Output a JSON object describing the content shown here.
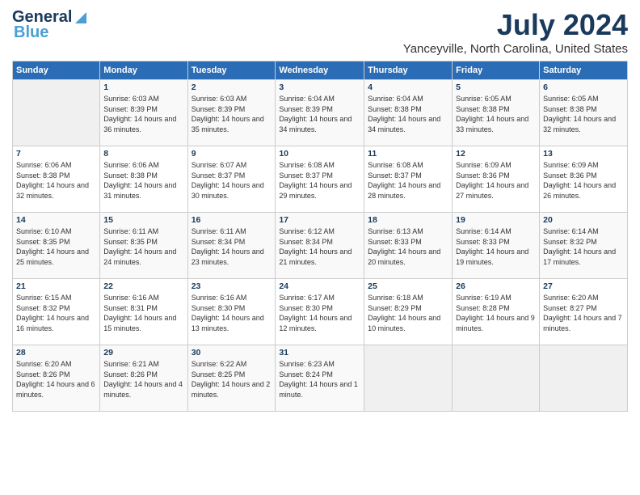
{
  "logo": {
    "line1": "General",
    "line2": "Blue"
  },
  "title": "July 2024",
  "subtitle": "Yanceyville, North Carolina, United States",
  "header": {
    "days": [
      "Sunday",
      "Monday",
      "Tuesday",
      "Wednesday",
      "Thursday",
      "Friday",
      "Saturday"
    ]
  },
  "weeks": [
    [
      {
        "num": "",
        "empty": true
      },
      {
        "num": "1",
        "rise": "6:03 AM",
        "set": "8:39 PM",
        "daylight": "14 hours and 36 minutes."
      },
      {
        "num": "2",
        "rise": "6:03 AM",
        "set": "8:39 PM",
        "daylight": "14 hours and 35 minutes."
      },
      {
        "num": "3",
        "rise": "6:04 AM",
        "set": "8:39 PM",
        "daylight": "14 hours and 34 minutes."
      },
      {
        "num": "4",
        "rise": "6:04 AM",
        "set": "8:38 PM",
        "daylight": "14 hours and 34 minutes."
      },
      {
        "num": "5",
        "rise": "6:05 AM",
        "set": "8:38 PM",
        "daylight": "14 hours and 33 minutes."
      },
      {
        "num": "6",
        "rise": "6:05 AM",
        "set": "8:38 PM",
        "daylight": "14 hours and 32 minutes."
      }
    ],
    [
      {
        "num": "7",
        "rise": "6:06 AM",
        "set": "8:38 PM",
        "daylight": "14 hours and 32 minutes."
      },
      {
        "num": "8",
        "rise": "6:06 AM",
        "set": "8:38 PM",
        "daylight": "14 hours and 31 minutes."
      },
      {
        "num": "9",
        "rise": "6:07 AM",
        "set": "8:37 PM",
        "daylight": "14 hours and 30 minutes."
      },
      {
        "num": "10",
        "rise": "6:08 AM",
        "set": "8:37 PM",
        "daylight": "14 hours and 29 minutes."
      },
      {
        "num": "11",
        "rise": "6:08 AM",
        "set": "8:37 PM",
        "daylight": "14 hours and 28 minutes."
      },
      {
        "num": "12",
        "rise": "6:09 AM",
        "set": "8:36 PM",
        "daylight": "14 hours and 27 minutes."
      },
      {
        "num": "13",
        "rise": "6:09 AM",
        "set": "8:36 PM",
        "daylight": "14 hours and 26 minutes."
      }
    ],
    [
      {
        "num": "14",
        "rise": "6:10 AM",
        "set": "8:35 PM",
        "daylight": "14 hours and 25 minutes."
      },
      {
        "num": "15",
        "rise": "6:11 AM",
        "set": "8:35 PM",
        "daylight": "14 hours and 24 minutes."
      },
      {
        "num": "16",
        "rise": "6:11 AM",
        "set": "8:34 PM",
        "daylight": "14 hours and 23 minutes."
      },
      {
        "num": "17",
        "rise": "6:12 AM",
        "set": "8:34 PM",
        "daylight": "14 hours and 21 minutes."
      },
      {
        "num": "18",
        "rise": "6:13 AM",
        "set": "8:33 PM",
        "daylight": "14 hours and 20 minutes."
      },
      {
        "num": "19",
        "rise": "6:14 AM",
        "set": "8:33 PM",
        "daylight": "14 hours and 19 minutes."
      },
      {
        "num": "20",
        "rise": "6:14 AM",
        "set": "8:32 PM",
        "daylight": "14 hours and 17 minutes."
      }
    ],
    [
      {
        "num": "21",
        "rise": "6:15 AM",
        "set": "8:32 PM",
        "daylight": "14 hours and 16 minutes."
      },
      {
        "num": "22",
        "rise": "6:16 AM",
        "set": "8:31 PM",
        "daylight": "14 hours and 15 minutes."
      },
      {
        "num": "23",
        "rise": "6:16 AM",
        "set": "8:30 PM",
        "daylight": "14 hours and 13 minutes."
      },
      {
        "num": "24",
        "rise": "6:17 AM",
        "set": "8:30 PM",
        "daylight": "14 hours and 12 minutes."
      },
      {
        "num": "25",
        "rise": "6:18 AM",
        "set": "8:29 PM",
        "daylight": "14 hours and 10 minutes."
      },
      {
        "num": "26",
        "rise": "6:19 AM",
        "set": "8:28 PM",
        "daylight": "14 hours and 9 minutes."
      },
      {
        "num": "27",
        "rise": "6:20 AM",
        "set": "8:27 PM",
        "daylight": "14 hours and 7 minutes."
      }
    ],
    [
      {
        "num": "28",
        "rise": "6:20 AM",
        "set": "8:26 PM",
        "daylight": "14 hours and 6 minutes."
      },
      {
        "num": "29",
        "rise": "6:21 AM",
        "set": "8:26 PM",
        "daylight": "14 hours and 4 minutes."
      },
      {
        "num": "30",
        "rise": "6:22 AM",
        "set": "8:25 PM",
        "daylight": "14 hours and 2 minutes."
      },
      {
        "num": "31",
        "rise": "6:23 AM",
        "set": "8:24 PM",
        "daylight": "14 hours and 1 minute."
      },
      {
        "num": "",
        "empty": true
      },
      {
        "num": "",
        "empty": true
      },
      {
        "num": "",
        "empty": true
      }
    ]
  ]
}
